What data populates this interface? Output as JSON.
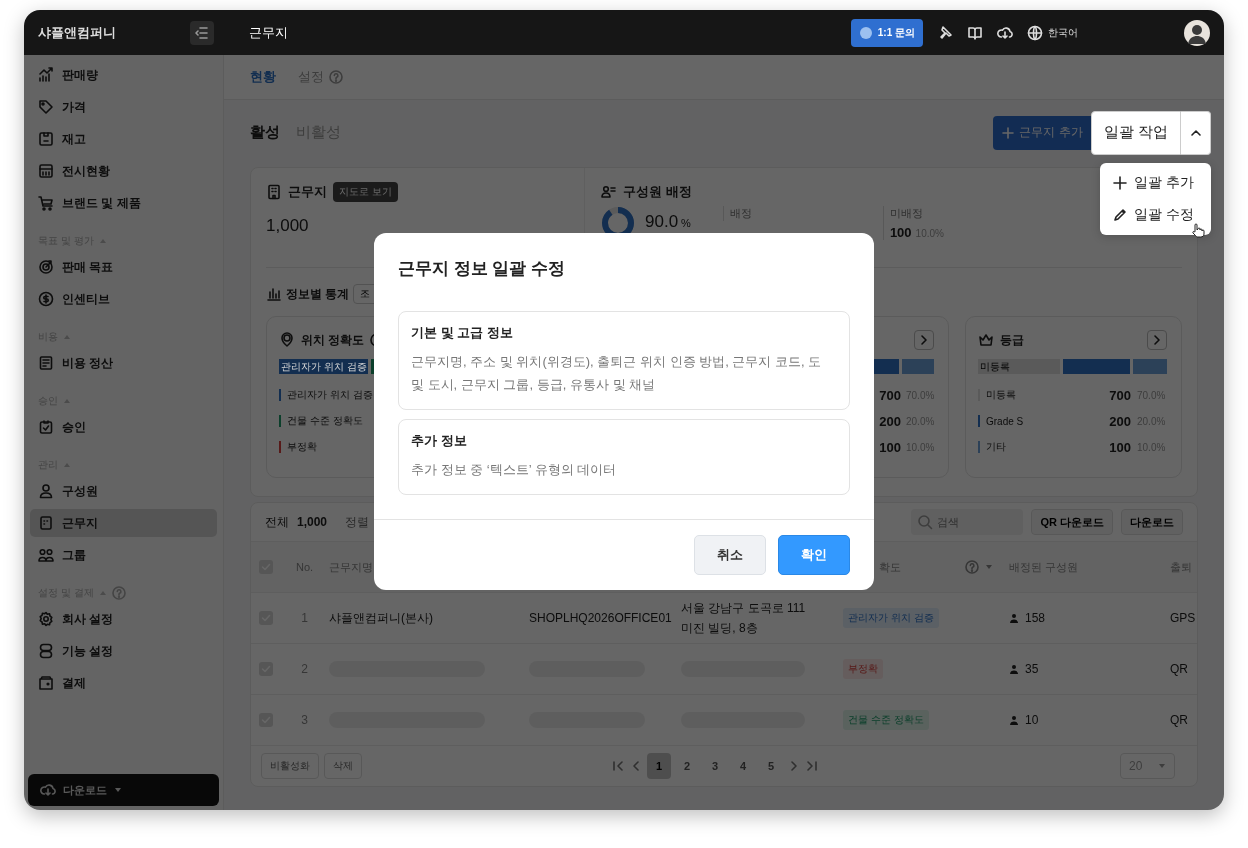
{
  "topbar": {
    "company": "샤플앤컴퍼니",
    "title": "근무지",
    "inquiry": "1:1 문의",
    "language": "한국어"
  },
  "sidebar": {
    "groups": [
      {
        "items": [
          {
            "label": "판매량",
            "selected": false
          },
          {
            "label": "가격",
            "selected": false
          },
          {
            "label": "재고",
            "selected": false
          },
          {
            "label": "전시현황",
            "selected": false
          },
          {
            "label": "브랜드 및 제품",
            "selected": false
          }
        ]
      },
      {
        "title": "목표 및 평가",
        "expanded": true,
        "items": [
          {
            "label": "판매 목표",
            "selected": false
          },
          {
            "label": "인센티브",
            "selected": false
          }
        ]
      },
      {
        "title": "비용",
        "expanded": true,
        "items": [
          {
            "label": "비용 정산",
            "selected": false
          }
        ]
      },
      {
        "title": "승인",
        "expanded": true,
        "items": [
          {
            "label": "승인",
            "selected": false
          }
        ]
      },
      {
        "title": "관리",
        "expanded": true,
        "items": [
          {
            "label": "구성원",
            "selected": false
          },
          {
            "label": "근무지",
            "selected": true
          },
          {
            "label": "그룹",
            "selected": false
          }
        ]
      },
      {
        "title": "설정 및 결제",
        "expanded": true,
        "help": true,
        "items": [
          {
            "label": "회사 설정",
            "selected": false
          },
          {
            "label": "기능 설정",
            "selected": false
          },
          {
            "label": "결제",
            "selected": false
          }
        ]
      }
    ],
    "download": "다운로드"
  },
  "page_tabs": [
    {
      "label": "현황",
      "selected": true
    },
    {
      "label": "설정",
      "selected": false,
      "help": true
    }
  ],
  "status_tabs": [
    {
      "label": "활성",
      "selected": true
    },
    {
      "label": "비활성",
      "selected": false
    }
  ],
  "add_button": "근무지 추가",
  "bulk_actions": {
    "label": "일괄 작업",
    "expanded": true,
    "items": [
      {
        "label": "일괄 추가",
        "kind": "add",
        "hovered": false
      },
      {
        "label": "일괄 수정",
        "kind": "edit",
        "hovered": true
      }
    ]
  },
  "summary": {
    "sites": {
      "title": "근무지",
      "map_button": "지도로 보기",
      "count": "1,000"
    },
    "assignment": {
      "title": "구성원 배정",
      "percent": "90.0",
      "unit": "%",
      "assigned_label": "배정",
      "unassigned_label": "미배정",
      "unassigned_count": "100",
      "unassigned_percent": "10.0%"
    }
  },
  "stats": {
    "title": "정보별 통계",
    "query_button": "조",
    "cards": [
      {
        "title": "위치 정확도",
        "help": true,
        "segments": [
          {
            "label": "관리자가 위치 검증",
            "color": "#132e50"
          },
          {
            "color": "#0c3f2b"
          }
        ],
        "rows": [
          {
            "label": "관리자가 위치 검증",
            "color": "#132e50"
          },
          {
            "label": "건물 수준 정확도",
            "color": "#0c3f2b"
          },
          {
            "label": "부정확",
            "color": "#571a19"
          }
        ]
      },
      {
        "link": true,
        "segments": [
          {
            "color": "#132e50"
          },
          {
            "color": "#2c4158"
          }
        ],
        "rows": [
          {
            "value": "700",
            "percent": "70.0%"
          },
          {
            "value": "200",
            "percent": "20.0%"
          },
          {
            "value": "100",
            "percent": "10.0%"
          }
        ]
      },
      {
        "title": "등급",
        "link": true,
        "segments": [
          {
            "label": "미등록",
            "color": "#5a5a5a"
          },
          {
            "color": "#132e50"
          },
          {
            "color": "#2c4158"
          }
        ],
        "rows": [
          {
            "label": "미등록",
            "value": "700",
            "percent": "70.0%",
            "color": "#5a5a5a"
          },
          {
            "label": "Grade S",
            "value": "200",
            "percent": "20.0%",
            "color": "#132e50"
          },
          {
            "label": "기타",
            "value": "100",
            "percent": "10.0%",
            "color": "#2c4158"
          }
        ]
      }
    ]
  },
  "table": {
    "total_label": "전체",
    "total": "1,000",
    "sort_label": "정렬",
    "search_placeholder": "검색",
    "qr_button": "QR 다운로드",
    "download_button": "다운로드",
    "header_checked": true,
    "columns": [
      {
        "label": "No."
      },
      {
        "label": "근무지명"
      },
      {},
      {},
      {
        "label": "확도",
        "help": true,
        "sortable": true
      },
      {
        "label": "배정된 구성원"
      },
      {
        "label": "출퇴"
      }
    ],
    "rows": [
      {
        "checked": true,
        "no": "1",
        "loading": false,
        "name": "샤플앤컴퍼니(본사)",
        "code": "SHOPLHQ2026OFFICE01",
        "address": "서울 강남구 도곡로 111\n미진 빌딩, 8층",
        "accuracy": {
          "label": "관리자가 위치 검증",
          "kind": "verified"
        },
        "members": "158",
        "method": "GPS"
      },
      {
        "checked": true,
        "no": "2",
        "loading": true,
        "accuracy": {
          "label": "부정확",
          "kind": "inaccurate"
        },
        "members": "35",
        "method": "QR"
      },
      {
        "checked": true,
        "no": "3",
        "loading": true,
        "accuracy": {
          "label": "건물 수준 정확도",
          "kind": "building"
        },
        "members": "10",
        "method": "QR"
      }
    ],
    "footer_buttons": [
      "비활성화",
      "삭제"
    ],
    "pages": [
      {
        "label": "1",
        "selected": true
      },
      {
        "label": "2",
        "selected": false
      },
      {
        "label": "3",
        "selected": false
      },
      {
        "label": "4",
        "selected": false
      },
      {
        "label": "5",
        "selected": false
      }
    ],
    "page_size": "20"
  },
  "modal": {
    "title": "근무지 정보 일괄 수정",
    "options": [
      {
        "title": "기본 및 고급 정보",
        "description": "근무지명, 주소 및 위치(위경도), 출퇴근 위치 인증 방법, 근무지 코드, 도 및 도시, 근무지 그룹, 등급, 유통사 및 채널"
      },
      {
        "title": "추가 정보",
        "description": "추가 정보 중 ‘텍스트’ 유형의 데이터"
      }
    ],
    "cancel": "취소",
    "confirm": "확인"
  }
}
